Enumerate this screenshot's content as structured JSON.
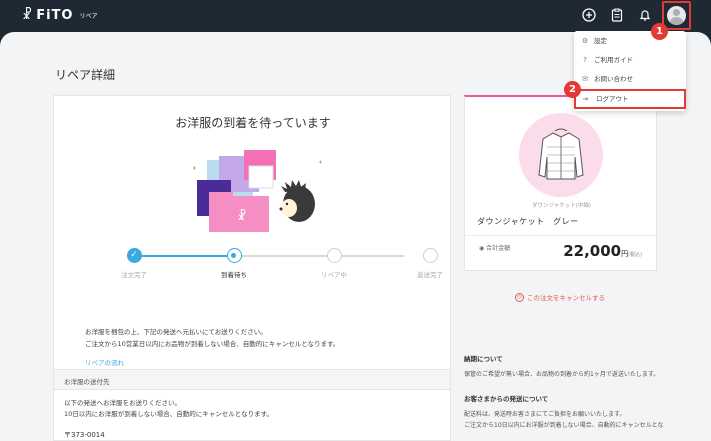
{
  "header": {
    "logo": "FiTO",
    "logo_mark": "☧",
    "logo_sub": "リペア",
    "icons": [
      "plus-circle-icon",
      "clipboard-icon",
      "bell-icon",
      "user-avatar-icon"
    ]
  },
  "page": {
    "title": "リペア詳細"
  },
  "status_card": {
    "heading": "お洋服の到着を待っています",
    "steps": [
      {
        "label": "注文完了",
        "state": "done"
      },
      {
        "label": "到着待ち",
        "state": "current"
      },
      {
        "label": "リペア中",
        "state": "pending"
      },
      {
        "label": "返送完了",
        "state": "pending"
      }
    ],
    "desc_line1": "お洋服を梱包の上、下記の発送へ元払いにてお送りください。",
    "desc_line2": "ご注文から10営業日以内にお品物が到着しない場合、自動的にキャンセルとなります。",
    "flow_link": "リペアの流れ"
  },
  "ship_card": {
    "header": "お洋服の送付先",
    "line1": "以下の発送へお洋服をお送りください。",
    "line2": "10日以内にお洋服が到着しない場合、自動的にキャンセルとなります。",
    "zip": "〒373-0014"
  },
  "item_card": {
    "category": "ダウンジャケット(中綿)",
    "name": "ダウンジャケット　グレー",
    "total_label": "合計金額",
    "total_value": "22,000",
    "currency": "円",
    "tax_note": "(税込)",
    "accent": "#e85aa3"
  },
  "cancel_link": "この注文をキャンセルする",
  "info": {
    "delivery_heading": "納期について",
    "delivery_text": "保管のご希望が無い場合、お品物の到着から約1ヶ月で返送いたします。",
    "shipping_heading": "お客さまからの発送について",
    "shipping_text1": "配送料は、発送時お客さまにてご負担をお願いいたします。",
    "shipping_text2": "ご注文から10日以内にお洋服が到着しない場合、自動的にキャンセルとな"
  },
  "dropdown": {
    "items": [
      {
        "label": "設定",
        "icon": "gear-icon"
      },
      {
        "label": "ご利用ガイド",
        "icon": "help-icon"
      },
      {
        "label": "お問い合わせ",
        "icon": "mail-icon"
      },
      {
        "label": "ログアウト",
        "icon": "logout-icon"
      }
    ]
  },
  "badges": [
    "1",
    "2"
  ],
  "colors": {
    "header_bg": "#1f2933",
    "primary": "#3aa9df",
    "highlight": "#e53935",
    "cancel": "#e55a4e"
  }
}
